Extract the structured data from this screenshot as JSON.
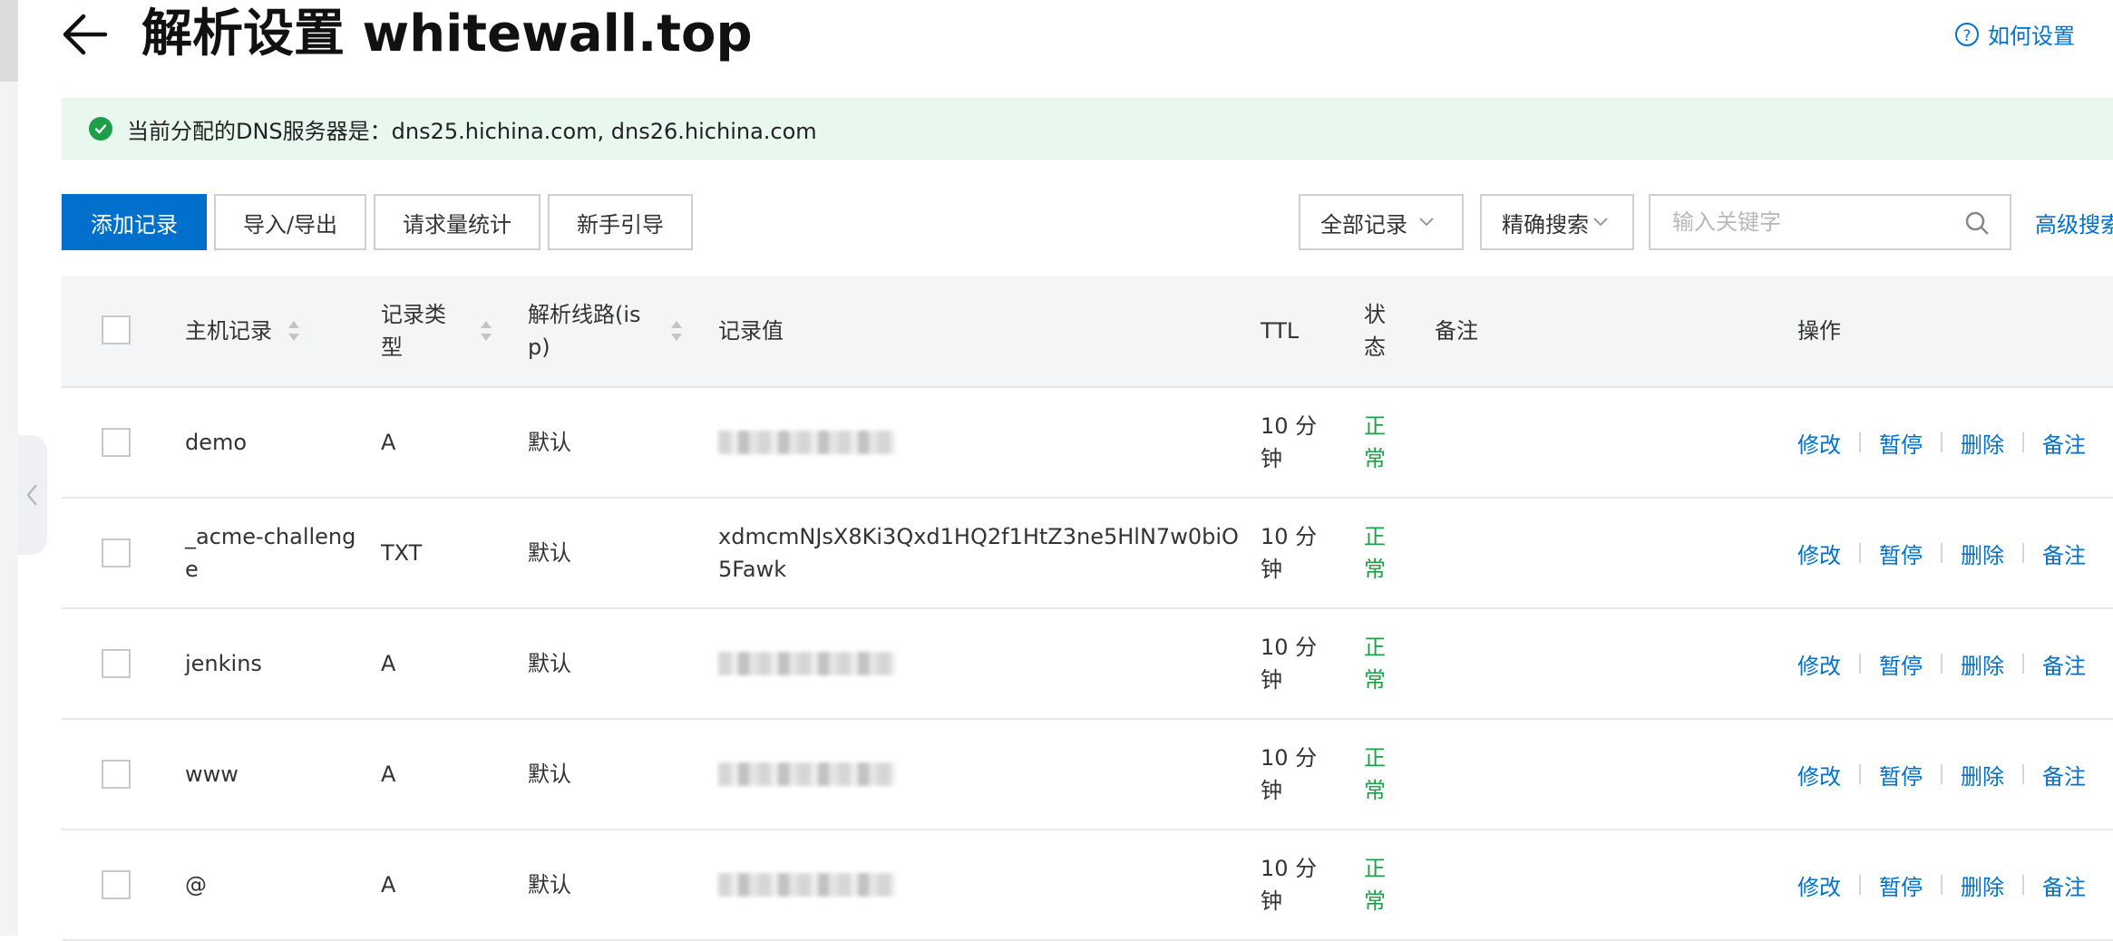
{
  "header": {
    "title": "解析设置 whitewall.top",
    "help_link": "如何设置",
    "help_icon": "?"
  },
  "notice": {
    "text": "当前分配的DNS服务器是：dns25.hichina.com, dns26.hichina.com"
  },
  "toolbar": {
    "add_record": "添加记录",
    "import_export": "导入/导出",
    "request_stats": "请求量统计",
    "beginner_guide": "新手引导",
    "record_filter": "全部记录",
    "search_mode": "精确搜索",
    "search_placeholder": "输入关键字",
    "advanced_search": "高级搜索"
  },
  "table": {
    "headers": {
      "host": "主机记录",
      "type_line1": "记录类",
      "type_line2": "型",
      "line_line1": "解析线路(is",
      "line_line2": "p)",
      "value": "记录值",
      "ttl": "TTL",
      "status_line1": "状",
      "status_line2": "态",
      "remark": "备注",
      "actions": "操作"
    },
    "actions": [
      "修改",
      "暂停",
      "删除",
      "备注"
    ],
    "rows": [
      {
        "host_line1": "demo",
        "host_line2": "",
        "type": "A",
        "line": "默认",
        "value_line1": "",
        "value_line2": "",
        "ttl_line1": "10 分",
        "ttl_line2": "钟",
        "status_line1": "正",
        "status_line2": "常"
      },
      {
        "host_line1": "_acme-challeng",
        "host_line2": "e",
        "type": "TXT",
        "line": "默认",
        "value_line1": "xdmcmNJsX8Ki3Qxd1HQ2f1HtZ3ne5HlN7w0biO",
        "value_line2": "5Fawk",
        "ttl_line1": "10 分",
        "ttl_line2": "钟",
        "status_line1": "正",
        "status_line2": "常"
      },
      {
        "host_line1": "jenkins",
        "host_line2": "",
        "type": "A",
        "line": "默认",
        "value_line1": "",
        "value_line2": "",
        "ttl_line1": "10 分",
        "ttl_line2": "钟",
        "status_line1": "正",
        "status_line2": "常"
      },
      {
        "host_line1": "www",
        "host_line2": "",
        "type": "A",
        "line": "默认",
        "value_line1": "",
        "value_line2": "",
        "ttl_line1": "10 分",
        "ttl_line2": "钟",
        "status_line1": "正",
        "status_line2": "常"
      },
      {
        "host_line1": "@",
        "host_line2": "",
        "type": "A",
        "line": "默认",
        "value_line1": "",
        "value_line2": "",
        "ttl_line1": "10 分",
        "ttl_line2": "钟",
        "status_line1": "正",
        "status_line2": "常"
      }
    ]
  },
  "colors": {
    "accent": "#0070cc",
    "status_ok": "#1e9e48",
    "notice_bg": "#e9f8ee"
  }
}
